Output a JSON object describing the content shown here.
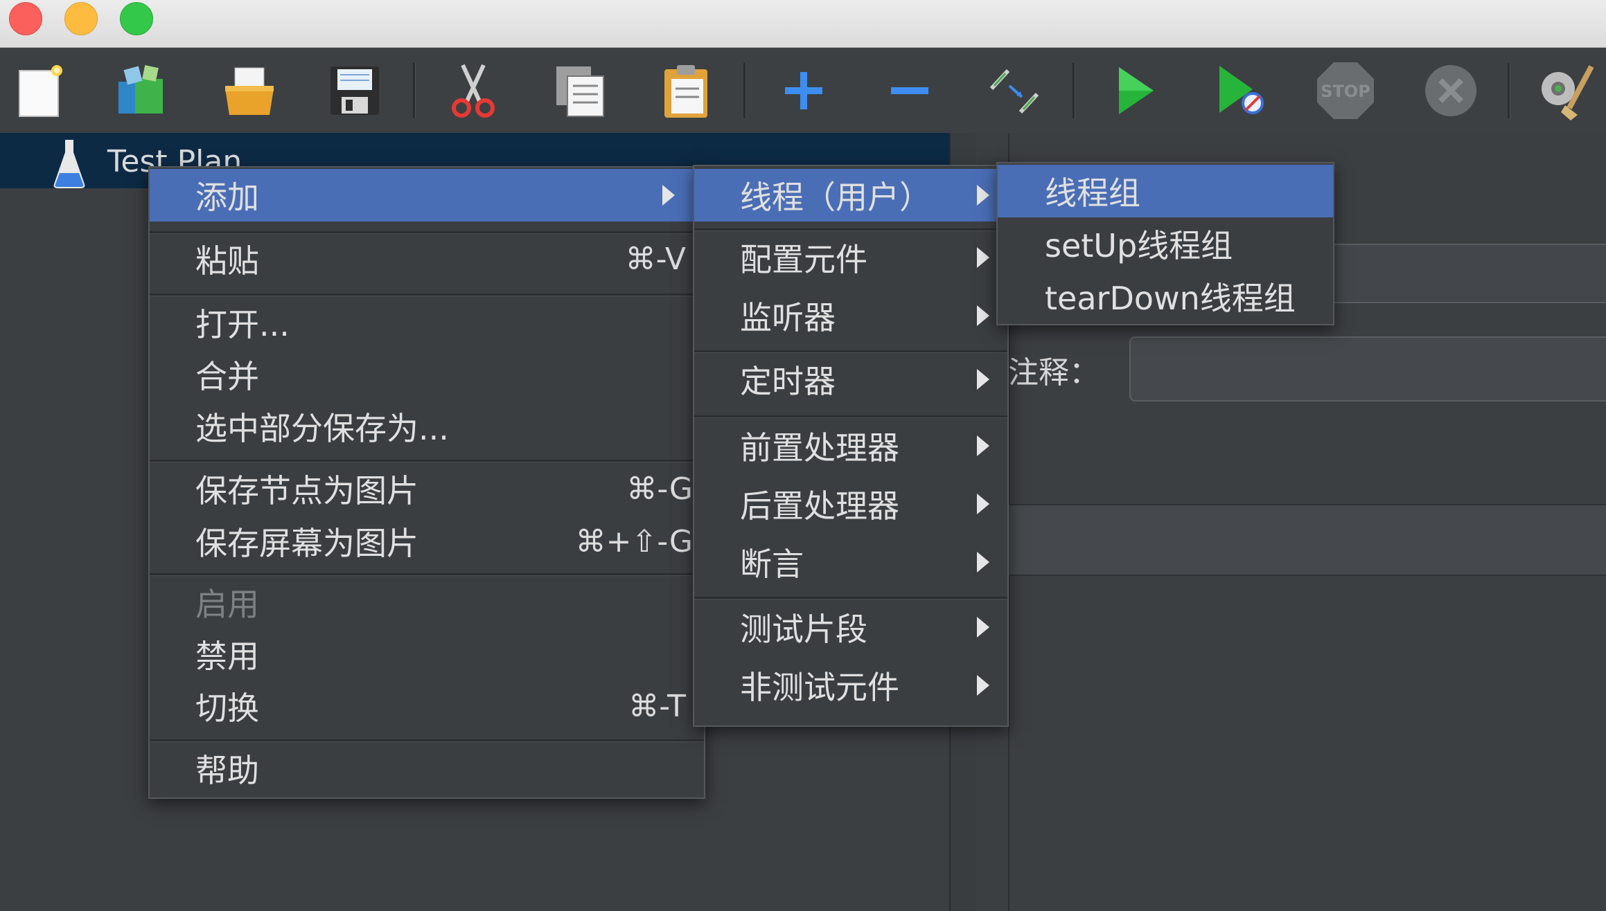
{
  "tree": {
    "root_label": "Test Plan"
  },
  "right_panel": {
    "comment_label": "注释："
  },
  "context_menu": {
    "items": [
      {
        "label": "添加"
      },
      {
        "label": "粘贴",
        "shortcut": "⌘-V"
      },
      {
        "label": "打开..."
      },
      {
        "label": "合并"
      },
      {
        "label": "选中部分保存为..."
      },
      {
        "label": "保存节点为图片",
        "shortcut": "⌘-G"
      },
      {
        "label": "保存屏幕为图片",
        "shortcut": "⌘+⇧-G"
      },
      {
        "label": "启用"
      },
      {
        "label": "禁用"
      },
      {
        "label": "切换",
        "shortcut": "⌘-T"
      },
      {
        "label": "帮助"
      }
    ]
  },
  "add_submenu": {
    "items": [
      {
        "label": "线程（用户）"
      },
      {
        "label": "配置元件"
      },
      {
        "label": "监听器"
      },
      {
        "label": "定时器"
      },
      {
        "label": "前置处理器"
      },
      {
        "label": "后置处理器"
      },
      {
        "label": "断言"
      },
      {
        "label": "测试片段"
      },
      {
        "label": "非测试元件"
      }
    ]
  },
  "threads_submenu": {
    "items": [
      {
        "label": "线程组"
      },
      {
        "label": "setUp线程组"
      },
      {
        "label": "tearDown线程组"
      }
    ]
  },
  "colors": {
    "selection": "#4a6eb6",
    "menu_bg": "#3b3e41",
    "tree_selection": "#0d2a45"
  },
  "toolbar_icons": [
    "new-icon",
    "templates-icon",
    "open-icon",
    "save-icon",
    "cut-icon",
    "copy-icon",
    "paste-icon",
    "expand-icon",
    "collapse-icon",
    "toggle-icon",
    "start-icon",
    "start-no-pause-icon",
    "stop-icon",
    "shutdown-icon",
    "clear-icon"
  ]
}
